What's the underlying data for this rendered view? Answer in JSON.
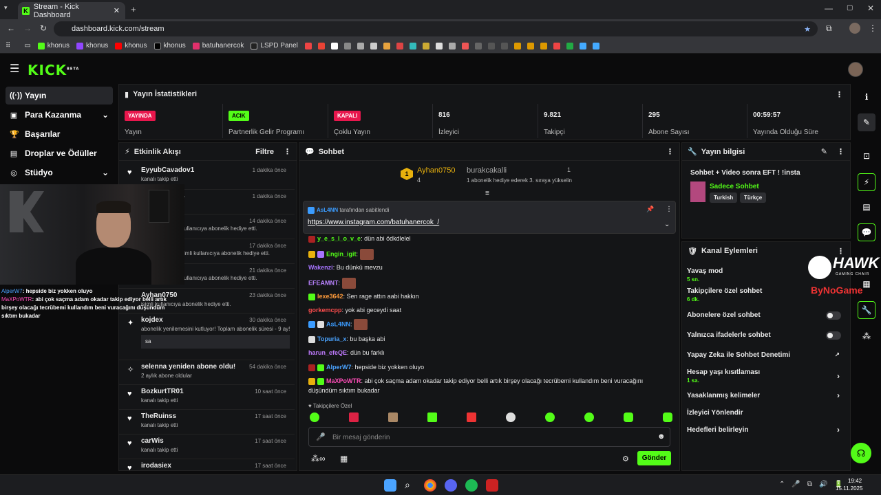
{
  "browser": {
    "tab_title": "Stream - Kick Dashboard",
    "url": "dashboard.kick.com/stream",
    "bookmarks": [
      "khonus",
      "khonus",
      "khonus",
      "khonus",
      "batuhanercok",
      "LSPD Panel"
    ]
  },
  "brand": {
    "logo": "KICK",
    "beta": "BETA"
  },
  "nav": {
    "items": [
      "Yayın",
      "Para Kazanma",
      "Başarılar",
      "Droplar ve Ödüller",
      "Stüdyo"
    ]
  },
  "stats": {
    "title": "Yayın İstatistikleri",
    "cells": [
      {
        "badge": "YAYINDA",
        "label": "Yayın"
      },
      {
        "badge": "ACIK",
        "label": "Partnerlik Gelir Programı"
      },
      {
        "badge": "KAPALI",
        "label": "Çoklu Yayın"
      },
      {
        "value": "816",
        "label": "İzleyici"
      },
      {
        "value": "9.821",
        "label": "Takipçi"
      },
      {
        "value": "295",
        "label": "Abone Sayısı"
      },
      {
        "value": "00:59:57",
        "label": "Yayında Olduğu Süre"
      }
    ]
  },
  "activity": {
    "title": "Etkinlik Akışı",
    "filter": "Filtre",
    "events": [
      {
        "name": "EyyubCavadov1",
        "sub": "kanalı takip etti",
        "time": "1 dakika önce"
      },
      {
        "name": "4",
        "sub": "",
        "time": "1 dakika önce"
      },
      {
        "name": "",
        "sub": "kullanıcıya abonelik hediye etti.",
        "time": "14 dakika önce"
      },
      {
        "name": "",
        "sub": "simli kullanıcıya abonelik hediye etti.",
        "time": "17 dakika önce"
      },
      {
        "name": "",
        "sub": "kullanıcıya abonelik hediye etti.",
        "time": "21 dakika önce"
      },
      {
        "name": "Ayhan0750",
        "sub": "isimli kullanıcıya abonelik hediye etti.",
        "time": "23 dakika önce"
      },
      {
        "name": "kojdex",
        "sub": "abonelik yenilemesini kutluyor! Toplam abonelik süresi - 9 ay!",
        "time": "30 dakika önce",
        "msg": "sa"
      },
      {
        "name": "selenna yeniden abone oldu!",
        "sub": "2 aylık abone oldular",
        "time": "54 dakika önce"
      },
      {
        "name": "BozkurtTR01",
        "sub": "kanalı takip etti",
        "time": "10 saat önce"
      },
      {
        "name": "TheRuinss",
        "sub": "kanalı takip etti",
        "time": "17 saat önce"
      },
      {
        "name": "carWis",
        "sub": "kanalı takip etti",
        "time": "17 saat önce"
      },
      {
        "name": "irodasiex",
        "sub": "",
        "time": "17 saat önce"
      }
    ]
  },
  "chat": {
    "title": "Sohbet",
    "leader1": {
      "name": "Ayhan0750",
      "rank": "1",
      "count": "4"
    },
    "leader2": {
      "name": "burakcakalli",
      "count": "1",
      "note": "1 abonelik hediye ederek 3. sıraya yükselin"
    },
    "pinned": {
      "by": "AsL4NN",
      "by_suffix": "tarafından sabitlendi",
      "link": "https://www.instagram.com/batuhanercok_/"
    },
    "messages": [
      {
        "user": "y_e_s_l_o_v_e",
        "text": ": dün abi ödkdlelel",
        "color": "#53fc18"
      },
      {
        "user": "Engin_igit",
        "text": ":",
        "color": "#53fc18"
      },
      {
        "user": "Wakenzi",
        "text": ": Bu dünkü mevzu",
        "color": "#a774ff"
      },
      {
        "user": "EFEAMNT",
        "text": ":",
        "color": "#b983ff"
      },
      {
        "user": "lexe3642",
        "text": ": Sen rage attın aabi hakkın",
        "color": "#ff9b3b"
      },
      {
        "user": "gorkemcpp",
        "text": ": yok abi geceydi saat",
        "color": "#ff4d4d"
      },
      {
        "user": "AsL4NN",
        "text": ":",
        "color": "#3b9cff"
      },
      {
        "user": "Topuria_x",
        "text": ": bu başka abi",
        "color": "#4aa3ff"
      },
      {
        "user": "harun_efeQE",
        "text": ": dün bu farklı",
        "color": "#c07bff"
      },
      {
        "user": "AlperW7",
        "text": ": hepside biz yokken oluyo",
        "color": "#4aa3ff"
      },
      {
        "user": "MaXPoWTR",
        "text": ": abi çok saçma adam okadar takip ediyor belli artık birşey olacağı tecrübemi kullandım beni vuracağını",
        "color": "#ff4db8"
      },
      {
        "user": "",
        "text": "düşündüm sıktım bukadar",
        "color": "#ffffff"
      }
    ],
    "followers_only": "Takipçilere Özel",
    "input_placeholder": "Bir mesaj gönderin",
    "send": "Gönder"
  },
  "overlay_chat": [
    {
      "user": "AlperW7",
      "text": ": hepside biz yokken oluyo"
    },
    {
      "user": "MaXPoWTR",
      "text": ": abi çok saçma adam okadar takip ediyor belli artık birşey olacağı tecrübemi kullandım beni vuracağını düşündüm sıktım bukadar"
    }
  ],
  "stream_info": {
    "title": "Yayın bilgisi",
    "stream_title": "Sohbet + Video sonra EFT ! !insta",
    "category": "Sadece Sohbet",
    "tags": [
      "Turkish",
      "Türkçe"
    ]
  },
  "channel_actions": {
    "title": "Kanal Eylemleri",
    "items": [
      {
        "label": "Yavaş mod",
        "sub": "5 sn."
      },
      {
        "label": "Takipçilere özel sohbet",
        "sub": "6 dk."
      },
      {
        "label": "Abonelere özel sohbet",
        "toggle": true
      },
      {
        "label": "Yalnızca ifadelerle sohbet",
        "toggle": true
      },
      {
        "label": "Yapay Zeka ile Sohbet Denetimi"
      },
      {
        "label": "Hesap yaşı kısıtlaması",
        "sub": "1 sa."
      },
      {
        "label": "Yasaklanmış kelimeler"
      },
      {
        "label": "İzleyici Yönlendir"
      },
      {
        "label": "Hedefleri belirleyin"
      }
    ]
  },
  "hawk": {
    "title": "HAWK",
    "sub": "GAMING CHAIR",
    "extra": "ByNoGame"
  },
  "taskbar": {
    "time": "19:42",
    "date": "15.11.2025"
  },
  "colors": {
    "accent": "#53fc18",
    "live": "#e8174d"
  }
}
